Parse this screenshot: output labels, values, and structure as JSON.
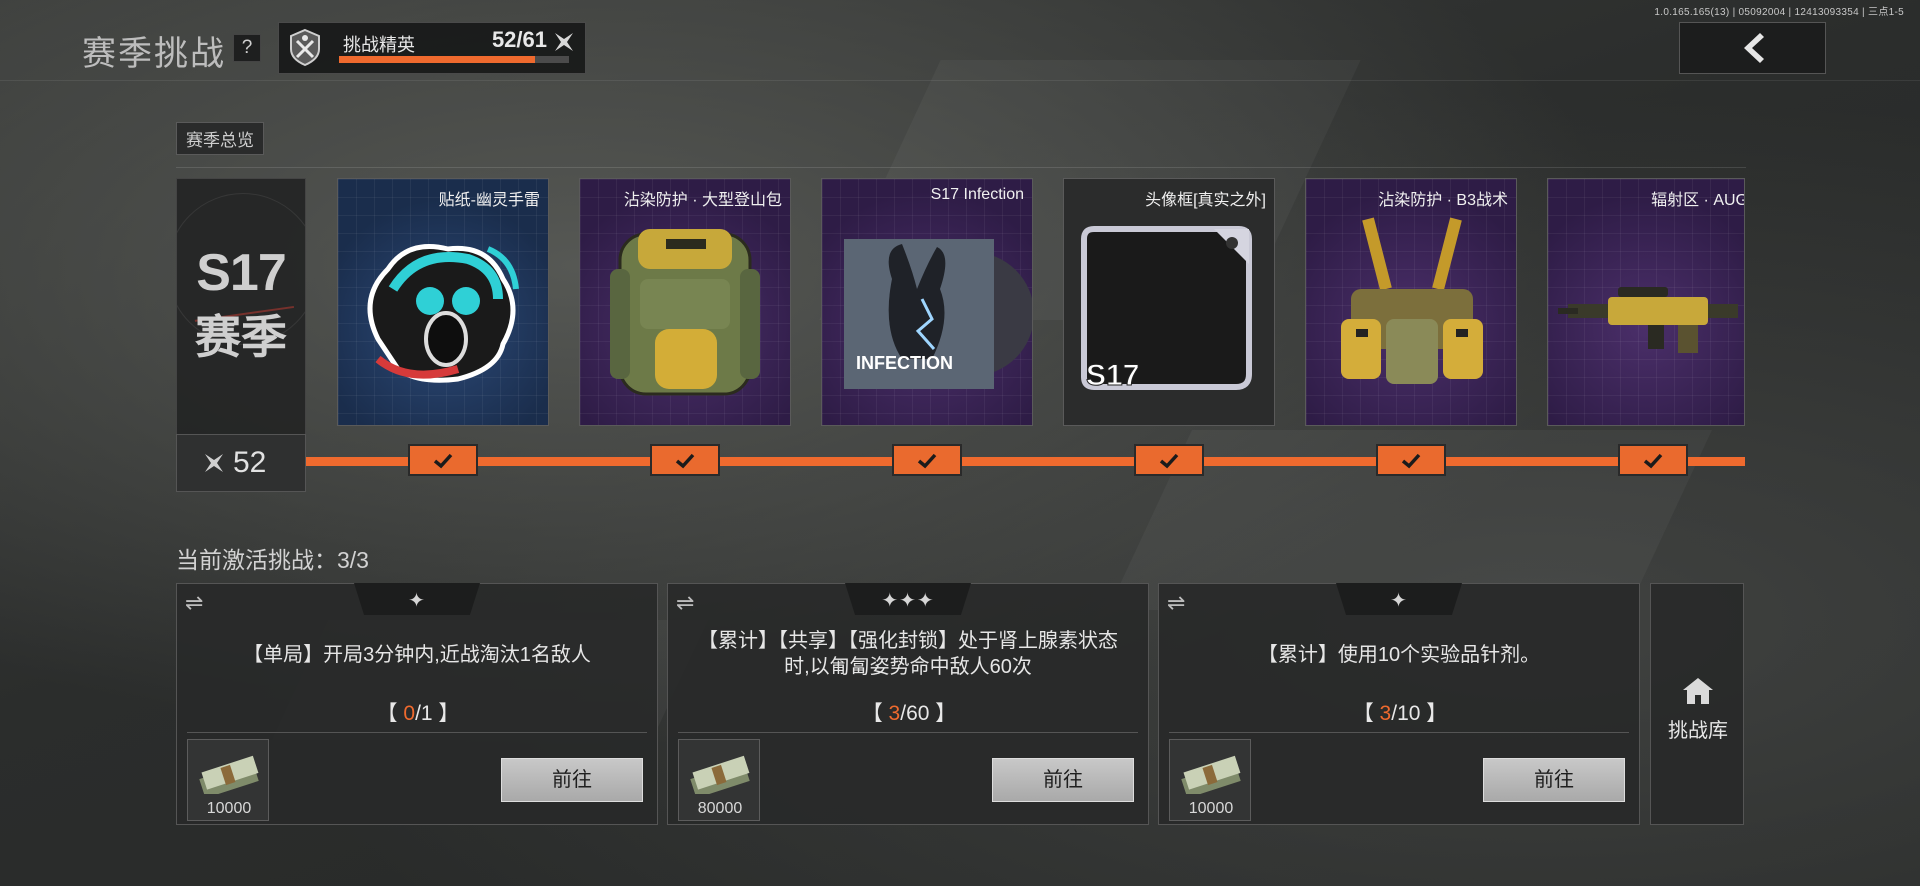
{
  "version_info": "1.0.165.165(13) | 05092004 | 12413093354 | 三点1-5",
  "header": {
    "title": "赛季挑战",
    "help_label": "?",
    "elite": {
      "name": "挑战精英",
      "count": "52/61",
      "progress": 0.85
    }
  },
  "overview": {
    "tab_label": "赛季总览",
    "season_code": "S17",
    "season_label": "赛季",
    "points": "52",
    "rewards": [
      {
        "name": "贴纸-幽灵手雷",
        "claimed": true
      },
      {
        "name": "沾染防护 · 大型登山包",
        "claimed": true
      },
      {
        "name": "S17 Infection",
        "claimed": true
      },
      {
        "name": "头像框[真实之外]",
        "claimed": true
      },
      {
        "name": "沾染防护 · B3战术",
        "claimed": true
      },
      {
        "name": "辐射区 · AUG",
        "claimed": true
      }
    ],
    "art_text": {
      "infection": "INFECTION",
      "frame_tag": "S17"
    }
  },
  "challenges": {
    "active_label": "当前激活挑战：3/3",
    "cards": [
      {
        "stars": "✦",
        "desc": "【单局】开局3分钟内,近战淘汰1名敌人",
        "open": "【 ",
        "current": "0",
        "total": "/1",
        "close": " 】",
        "reward": "10000",
        "go_label": "前往"
      },
      {
        "stars": "✦✦✦",
        "desc": "【累计】【共享】【强化封锁】处于肾上腺素状态时,以匍匐姿势命中敌人60次",
        "open": "【 ",
        "current": "3",
        "total": "/60",
        "close": " 】",
        "reward": "80000",
        "go_label": "前往"
      },
      {
        "stars": "✦",
        "desc": "【累计】使用10个实验品针剂。",
        "open": "【 ",
        "current": "3",
        "total": "/10",
        "close": " 】",
        "reward": "10000",
        "go_label": "前往"
      }
    ],
    "library_label": "挑战库"
  },
  "colors": {
    "accent": "#ef6a2e",
    "purple_tile": "#3a2456",
    "blue_tile": "#22385e"
  }
}
